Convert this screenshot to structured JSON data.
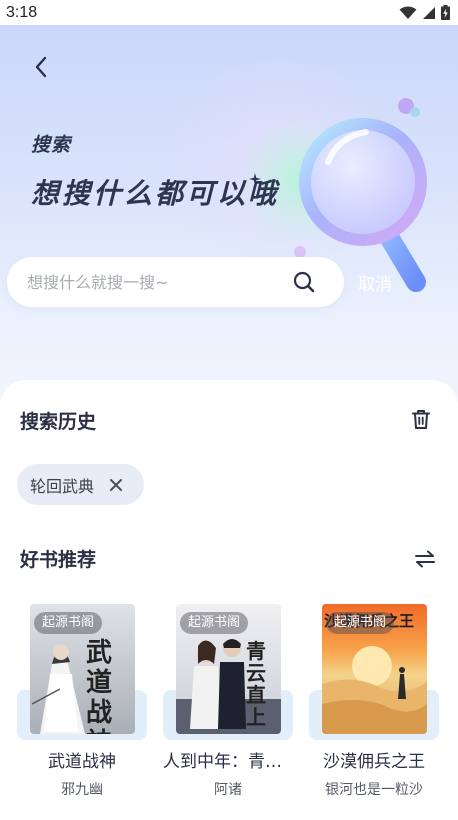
{
  "status_bar": {
    "time": "3:18",
    "icons": [
      "wifi-icon",
      "signal-icon",
      "battery-charging-icon"
    ]
  },
  "header": {
    "back_icon": "chevron-left-icon",
    "title": "搜索",
    "slogan": "想搜什么都可以哦"
  },
  "search": {
    "placeholder": "想搜什么就搜一搜~",
    "value": "",
    "icon": "search-icon",
    "cancel_label": "取消"
  },
  "history": {
    "title": "搜索历史",
    "clear_icon": "trash-icon",
    "items": [
      {
        "label": "轮回武典",
        "remove_icon": "close-icon"
      }
    ]
  },
  "recommend": {
    "title": "好书推荐",
    "refresh_icon": "swap-icon",
    "books": [
      {
        "badge": "起源书阁",
        "title": "武道战神",
        "author": "邪九幽",
        "cover_text": "武道战神"
      },
      {
        "badge": "起源书阁",
        "title": "人到中年：青云直上",
        "author": "阿诸",
        "cover_text": "青云直上"
      },
      {
        "badge": "起源书阁",
        "title": "沙漠佣兵之王",
        "author": "银河也是一粒沙",
        "cover_text": "沙漠佣兵之王"
      }
    ]
  },
  "colors": {
    "hero_top": "#c9d6fb",
    "title_text": "#2e3550",
    "chip_bg": "#e7ecf6",
    "book_card_bg": "#e3eefb"
  }
}
